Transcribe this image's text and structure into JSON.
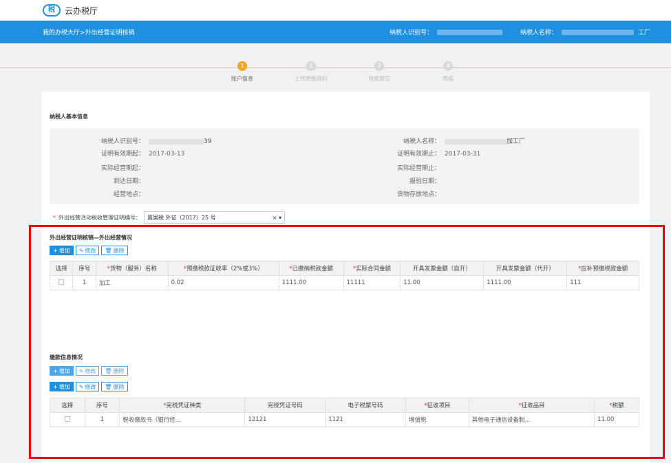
{
  "app": {
    "logo_mark": "税",
    "name": "云办税厅"
  },
  "breadcrumb": "我的办税大厅>外出经营证明核销",
  "header": {
    "taxpayer_id_label": "纳税人识别号：",
    "taxpayer_name_label": "纳税人名称：",
    "taxpayer_name_suffix": "工厂"
  },
  "steps": [
    {
      "num": "1",
      "label": "账户信息",
      "active": true
    },
    {
      "num": "2",
      "label": "上传附报资料",
      "active": false
    },
    {
      "num": "3",
      "label": "预览提交",
      "active": false
    },
    {
      "num": "4",
      "label": "完成",
      "active": false
    }
  ],
  "basic": {
    "title": "纳税人基本信息",
    "taxpayer_id_label": "纳税人识别号：",
    "taxpayer_id_suffix": "39",
    "taxpayer_name_label": "纳税人名称：",
    "taxpayer_name_suffix": "加工厂",
    "valid_from_label": "证明有效期起：",
    "valid_from": "2017-03-13",
    "valid_to_label": "证明有效期止：",
    "valid_to": "2017-03-31",
    "actual_from_label": "实际经营期起：",
    "actual_to_label": "实际经营期止：",
    "arrive_label": "到达日期：",
    "report_label": "报验日期：",
    "place_label": "经营地点：",
    "storage_label": "货物存放地点："
  },
  "cert": {
    "label": "外出经营活动税收管理证明编号：",
    "value": "冀国税 外证〔2017〕25 号",
    "clear": "×",
    "caret": "▾"
  },
  "buttons": {
    "add": "增加",
    "edit": "修改",
    "delete": "删除",
    "add_icon": "+",
    "edit_icon": "✎",
    "delete_icon": "🗑"
  },
  "section1": {
    "title": "外出经营证明核销—外出经营情况",
    "headers": [
      "选择",
      "序号",
      "货物（服务）名称",
      "预缴税款征收率（2%或3%）",
      "已缴纳税款金额",
      "实际合同金额",
      "开具发票金额（自开）",
      "开具发票金额（代开）",
      "应补预缴税款金额"
    ],
    "required": [
      false,
      false,
      true,
      true,
      true,
      true,
      false,
      false,
      true
    ],
    "rows": [
      [
        "",
        "1",
        "加工",
        "0.02",
        "1111.00",
        "11111",
        "11.00",
        "1111.00",
        "111"
      ]
    ]
  },
  "section2": {
    "title": "缴款信息情况",
    "overlap_text": "缴款信息",
    "headers": [
      "选择",
      "序号",
      "完税凭证种类",
      "完税凭证号码",
      "电子税票号码",
      "征收项目",
      "征收品目",
      "税额"
    ],
    "required": [
      false,
      false,
      true,
      false,
      false,
      true,
      true,
      true
    ],
    "rows": [
      [
        "",
        "1",
        "税收缴款书（银行经...",
        "12121",
        "1121",
        "增值税",
        "其他电子通信设备制...",
        "11.00"
      ]
    ]
  },
  "colors": {
    "primary": "#1f8fe0",
    "step_active": "#f5a623",
    "highlight": "#e00000"
  }
}
